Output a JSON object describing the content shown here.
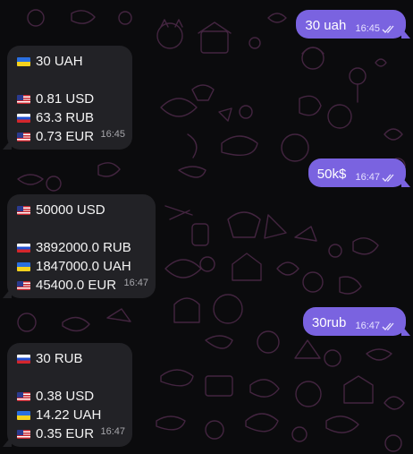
{
  "messages": [
    {
      "text": "30 uah",
      "time": "16:45"
    },
    {
      "header_flag": "ua",
      "header": "30 UAH",
      "lines": [
        {
          "flag": "us",
          "text": "0.81 USD"
        },
        {
          "flag": "ru",
          "text": "63.3 RUB"
        },
        {
          "flag": "us",
          "text": "0.73 EUR"
        }
      ],
      "time": "16:45"
    },
    {
      "text": "50k$",
      "time": "16:47"
    },
    {
      "header_flag": "us",
      "header": "50000 USD",
      "lines": [
        {
          "flag": "ru",
          "text": "3892000.0 RUB"
        },
        {
          "flag": "ua",
          "text": "1847000.0 UAH"
        },
        {
          "flag": "us",
          "text": "45400.0 EUR"
        }
      ],
      "time": "16:47"
    },
    {
      "text": "30rub",
      "time": "16:47"
    },
    {
      "header_flag": "ru",
      "header": "30 RUB",
      "lines": [
        {
          "flag": "us",
          "text": "0.38 USD"
        },
        {
          "flag": "ua",
          "text": "14.22 UAH"
        },
        {
          "flag": "us",
          "text": "0.35 EUR"
        }
      ],
      "time": "16:47"
    }
  ],
  "colors": {
    "outgoing_bubble": "#7a63e0",
    "incoming_bubble": "#222226",
    "background": "#0b0b0d",
    "doodle_stroke": "#4a2846"
  },
  "icons": {
    "read_receipt": "double-check-icon",
    "flags": [
      "flag-ua-icon",
      "flag-ru-icon",
      "flag-us-icon"
    ]
  }
}
